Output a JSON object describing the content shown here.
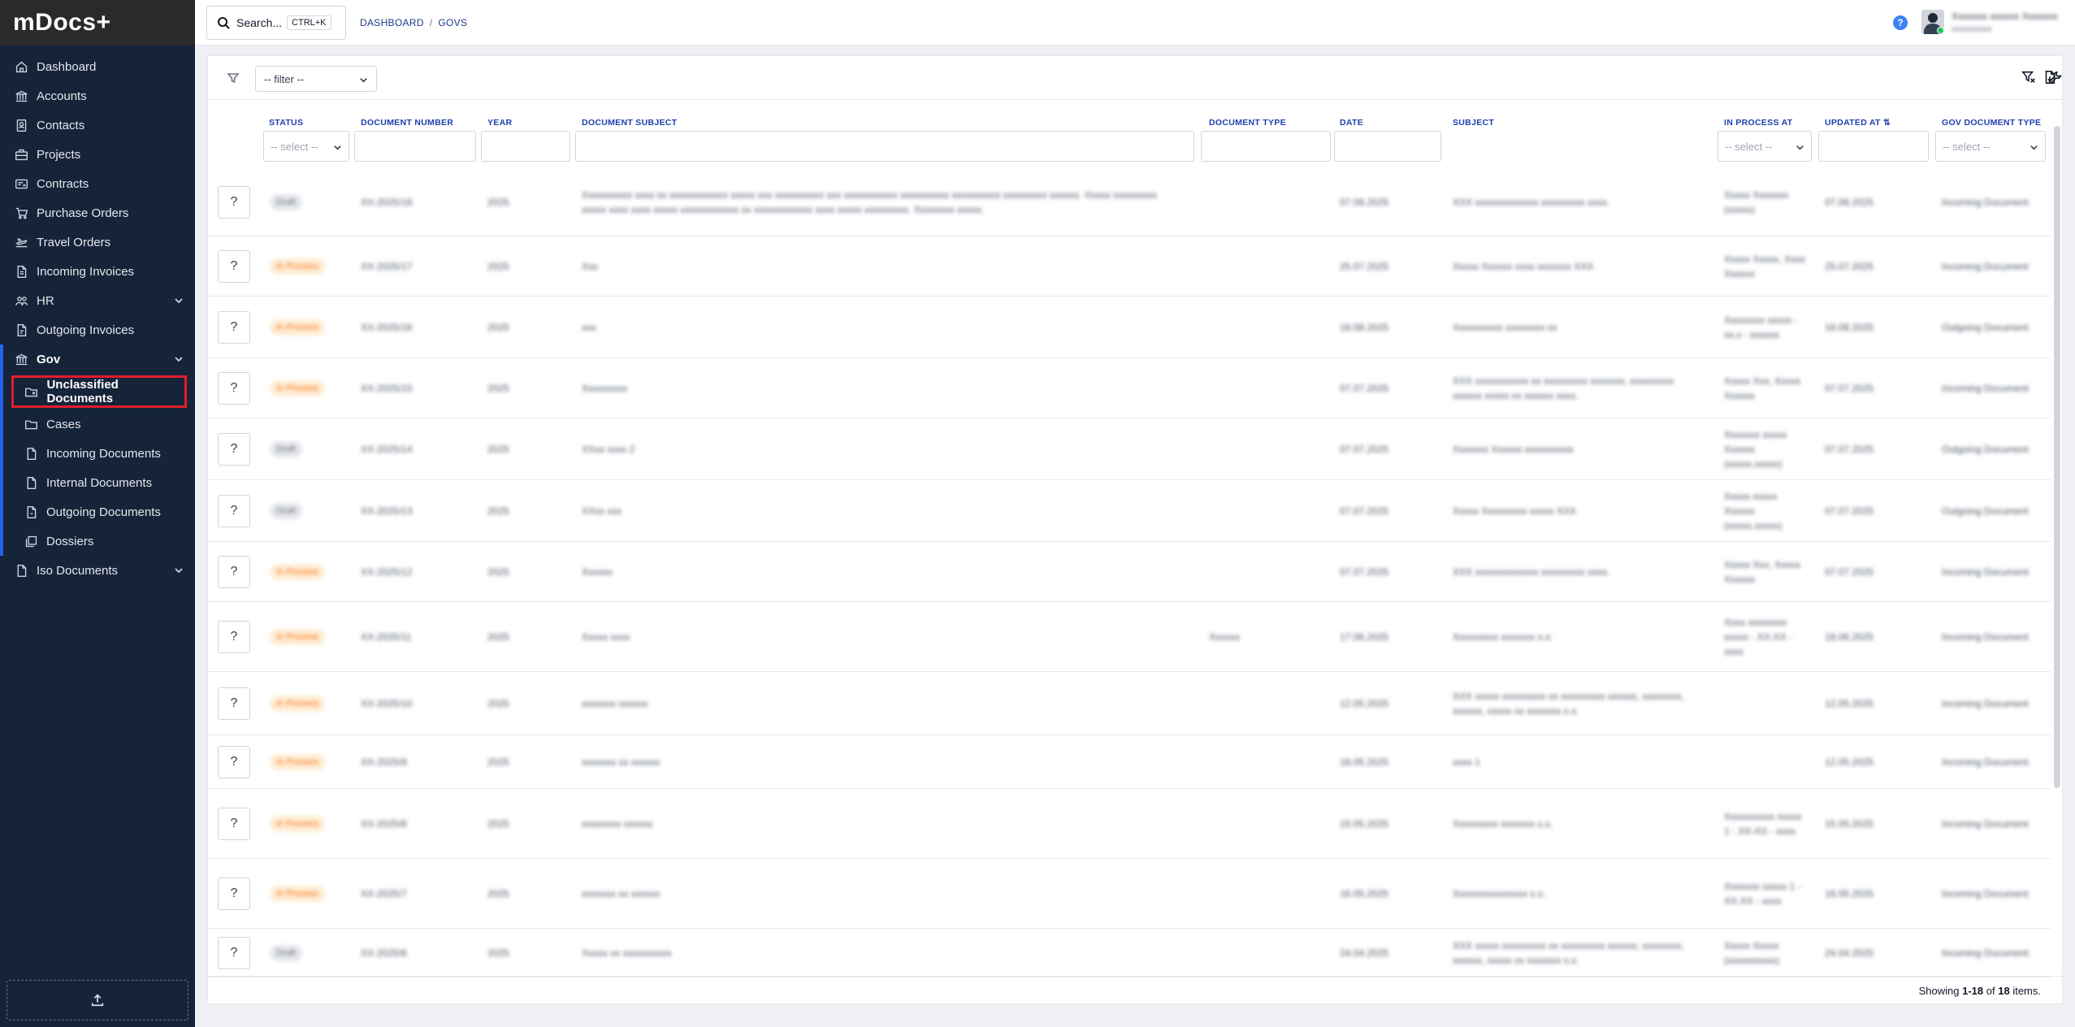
{
  "app": {
    "brand": "mDocs+"
  },
  "sidebar": {
    "items": [
      {
        "label": "Dashboard",
        "icon": "home-icon"
      },
      {
        "label": "Accounts",
        "icon": "bank-icon"
      },
      {
        "label": "Contacts",
        "icon": "contacts-icon"
      },
      {
        "label": "Projects",
        "icon": "briefcase-icon"
      },
      {
        "label": "Contracts",
        "icon": "contract-icon"
      },
      {
        "label": "Purchase Orders",
        "icon": "cart-icon"
      },
      {
        "label": "Travel Orders",
        "icon": "plane-icon"
      },
      {
        "label": "Incoming Invoices",
        "icon": "invoice-icon"
      },
      {
        "label": "HR",
        "icon": "users-icon"
      },
      {
        "label": "Outgoing Invoices",
        "icon": "invoice-out-icon"
      },
      {
        "label": "Gov",
        "icon": "gov-building-icon"
      },
      {
        "label": "Unclassified Documents",
        "icon": "folder-question-icon"
      },
      {
        "label": "Cases",
        "icon": "folder-icon"
      },
      {
        "label": "Incoming Documents",
        "icon": "document-in-icon"
      },
      {
        "label": "Internal Documents",
        "icon": "document-icon"
      },
      {
        "label": "Outgoing Documents",
        "icon": "document-out-icon"
      },
      {
        "label": "Dossiers",
        "icon": "stack-icon"
      },
      {
        "label": "Iso Documents",
        "icon": "iso-document-icon"
      }
    ]
  },
  "topbar": {
    "search_label": "Search...",
    "search_shortcut": "CTRL+K",
    "breadcrumb": [
      "DASHBOARD",
      "GOVS"
    ],
    "help": "?",
    "user_name": "Xxxxxxx xxxxxx Xxxxxxx",
    "user_role": "xxxxxxxxx"
  },
  "toolbar": {
    "filter_placeholder": "-- filter --"
  },
  "table": {
    "columns": [
      "STATUS",
      "DOCUMENT NUMBER",
      "YEAR",
      "DOCUMENT SUBJECT",
      "DOCUMENT TYPE",
      "DATE",
      "SUBJECT",
      "IN PROCESS AT",
      "UPDATED AT",
      "GOV DOCUMENT TYPE"
    ],
    "select_placeholder": "-- select --",
    "sort_icon": "sort-icon",
    "rows": [
      {
        "status": "Draft",
        "num": "XX-2025/18",
        "year": "2025",
        "subject": "Xxxxxxxxxx xxxx xx xxxxxxxxxxxx xxxxx xxx xxxxxxxxxx xxx xxxxxxxxxxx xxxxxxxxxx xxxxxxxxxx xxxxxxxxx xxxxxx. Xxxxx xxxxxxxxx xxxxx xxxx xxxx xxxxx xxxxxxxxxxxx xx xxxxxxxxxxxx xxxx xxxxx xxxxxxxxx. Xxxxxxxx xxxxx.",
        "dtype": "",
        "date": "07.08.2025",
        "subj2": "XXX xxxxxxxxxxxxx xxxxxxxxx xxxx.",
        "inproc": "Xxxxx Xxxxxxx (xxxxx)",
        "updated": "07.08.2025",
        "gtype": "Incoming Document"
      },
      {
        "status": "In Process",
        "num": "XX-2025/17",
        "year": "2025",
        "subject": "Xxx",
        "dtype": "",
        "date": "25.07.2025",
        "subj2": "Xxxxx Xxxxxx xxxx xxxxxxx XXX",
        "inproc": "Xxxxx Xxxxx, Xxxx Xxxxxx",
        "updated": "25.07.2025",
        "gtype": "Incoming Document"
      },
      {
        "status": "In Process",
        "num": "XX-2025/16",
        "year": "2025",
        "subject": "xxx",
        "dtype": "",
        "date": "18.08.2025",
        "subj2": "Xxxxxxxxxx xxxxxxxx xx",
        "inproc": "Xxxxxxxx xxxxx - xx.x - xxxxxx",
        "updated": "18.08.2025",
        "gtype": "Outgoing Document"
      },
      {
        "status": "In Process",
        "num": "XX-2025/15",
        "year": "2025",
        "subject": "Xxxxxxxxx",
        "dtype": "",
        "date": "07.07.2025",
        "subj2": "XXX xxxxxxxxxxx xx xxxxxxxxx xxxxxxx, xxxxxxxxx xxxxxx xxxxx xx xxxxxx xxxx.",
        "inproc": "Xxxxx Xxx, Xxxxx Xxxxxx",
        "updated": "07.07.2025",
        "gtype": "Incoming Document"
      },
      {
        "status": "Draft",
        "num": "XX-2025/14",
        "year": "2025",
        "subject": "XXxx xxxx 2",
        "dtype": "",
        "date": "07.07.2025",
        "subj2": "Xxxxxxx Xxxxxx xxxxxxxxxx",
        "inproc": "Xxxxxxx xxxxx Xxxxxx (xxxxx.xxxxx)",
        "updated": "07.07.2025",
        "gtype": "Outgoing Document"
      },
      {
        "status": "Draft",
        "num": "XX-2025/13",
        "year": "2025",
        "subject": "XXxx xxx",
        "dtype": "",
        "date": "07.07.2025",
        "subj2": "Xxxxx Xxxxxxxxx xxxxx XXX",
        "inproc": "Xxxxx xxxxx Xxxxxx (xxxxx.xxxxx)",
        "updated": "07.07.2025",
        "gtype": "Outgoing Document"
      },
      {
        "status": "In Process",
        "num": "XX-2025/12",
        "year": "2025",
        "subject": "Xxxxxx",
        "dtype": "",
        "date": "07.07.2025",
        "subj2": "XXX xxxxxxxxxxxxx xxxxxxxxx xxxx.",
        "inproc": "Xxxxx Xxx, Xxxxx Xxxxxx",
        "updated": "07.07.2025",
        "gtype": "Incoming Document"
      },
      {
        "status": "In Process",
        "num": "XX-2025/11",
        "year": "2025",
        "subject": "Xxxxx xxxx",
        "dtype": "Xxxxxx",
        "date": "17.06.2025",
        "subj2": "Xxxxxxxxx xxxxxxx x.x.",
        "inproc": "Xxxx xxxxxxxx xxxxx - XX-XX - xxxx",
        "updated": "18.06.2025",
        "gtype": "Incoming Document"
      },
      {
        "status": "In Process",
        "num": "XX-2025/10",
        "year": "2025",
        "subject": "xxxxxxx xxxxxx",
        "dtype": "",
        "date": "12.05.2025",
        "subj2": "XXX xxxxx xxxxxxxxx xx xxxxxxxxx xxxxxx, xxxxxxxx, xxxxxx, xxxxx xx xxxxxxx x.x.",
        "inproc": "",
        "updated": "12.05.2025",
        "gtype": "Incoming Document"
      },
      {
        "status": "In Process",
        "num": "XX-2025/9",
        "year": "2025",
        "subject": "xxxxxxx xx xxxxxx",
        "dtype": "",
        "date": "18.05.2025",
        "subj2": "xxxx 1",
        "inproc": "",
        "updated": "12.05.2025",
        "gtype": "Incoming Document"
      },
      {
        "status": "In Process",
        "num": "XX-2025/8",
        "year": "2025",
        "subject": "xxxxxxxx xxxxxx",
        "dtype": "",
        "date": "15.05.2025",
        "subj2": "Xxxxxxxxx xxxxxxx x.x.",
        "inproc": "Xxxxxxxxxx xxxxx 1 - XX-XX - xxxx",
        "updated": "15.05.2025",
        "gtype": "Incoming Document"
      },
      {
        "status": "In Process",
        "num": "XX-2025/7",
        "year": "2025",
        "subject": "xxxxxxx xx xxxxxx",
        "dtype": "",
        "date": "16.05.2025",
        "subj2": "Xxxxxxxxxxxxxxx x.x.",
        "inproc": "Xxxxxxx xxxxx 1 - XX-XX - xxxx",
        "updated": "16.05.2025",
        "gtype": "Incoming Document"
      },
      {
        "status": "Draft",
        "num": "XX-2025/6",
        "year": "2025",
        "subject": "Xxxxx xx xxxxxxxxxx",
        "dtype": "",
        "date": "24.04.2025",
        "subj2": "XXX xxxxx xxxxxxxxx xx xxxxxxxxx xxxxxx, xxxxxxxx, xxxxxx, xxxxx xx xxxxxxx x.x.",
        "inproc": "Xxxxx Xxxxx (xxxxxxxxxx)",
        "updated": "24.04.2025",
        "gtype": "Incoming Document"
      }
    ]
  },
  "footer": {
    "showing_prefix": "Showing ",
    "range": "1-18",
    "of_word": " of ",
    "total": "18",
    "items_word": " items."
  }
}
